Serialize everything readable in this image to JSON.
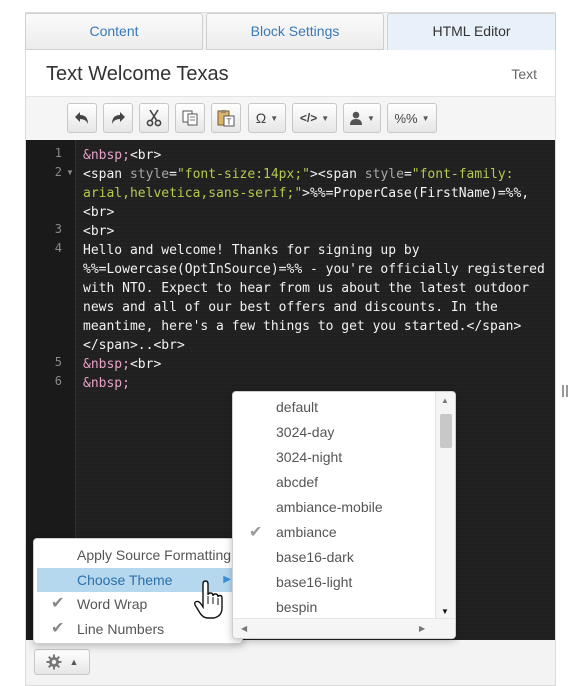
{
  "tabs": [
    {
      "label": "Content"
    },
    {
      "label": "Block Settings"
    },
    {
      "label": "HTML Editor"
    }
  ],
  "header": {
    "title": "Text Welcome Texas",
    "type_label": "Text"
  },
  "toolbar": {
    "special_char_label": "Ω",
    "code_label": "</>",
    "personalize_label": "%%"
  },
  "editor": {
    "line_numbers": [
      "1",
      "2",
      "3",
      "4",
      "5",
      "6"
    ],
    "lines": [
      {
        "num": "1",
        "text": "&nbsp;<br>"
      },
      {
        "num": "2",
        "text": "<span style=\"font-size:14px;\"><span style=\"font-family: arial,helvetica,sans-serif;\">%%=ProperCase(FirstName)=%%,<br>"
      },
      {
        "num": "3",
        "text": "<br>"
      },
      {
        "num": "4",
        "text": "Hello and welcome! Thanks for signing up by %%=Lowercase(OptInSource)=%% - you're officially registered with NTO. Expect to hear from us about the latest outdoor news and all of our best offers and discounts. In the meantime, here's a few things to get you started.</span></span>..<br>"
      },
      {
        "num": "5",
        "text": "&nbsp;<br>"
      },
      {
        "num": "6",
        "text": "&nbsp;"
      }
    ]
  },
  "context_menu": {
    "items": [
      {
        "label": "Apply Source Formatting",
        "checked": false
      },
      {
        "label": "Choose Theme",
        "checked": false,
        "highlighted": true
      },
      {
        "label": "Word Wrap",
        "checked": true
      },
      {
        "label": "Line Numbers",
        "checked": true
      }
    ]
  },
  "theme_menu": {
    "selected": "ambiance",
    "items": [
      "default",
      "3024-day",
      "3024-night",
      "abcdef",
      "ambiance-mobile",
      "ambiance",
      "base16-dark",
      "base16-light",
      "bespin"
    ]
  },
  "colors": {
    "accent": "#3a7ab8",
    "editor_bg": "#202020",
    "string": "#b7c84f",
    "entity": "#e8a1c8",
    "highlight": "#b6d8ee"
  }
}
